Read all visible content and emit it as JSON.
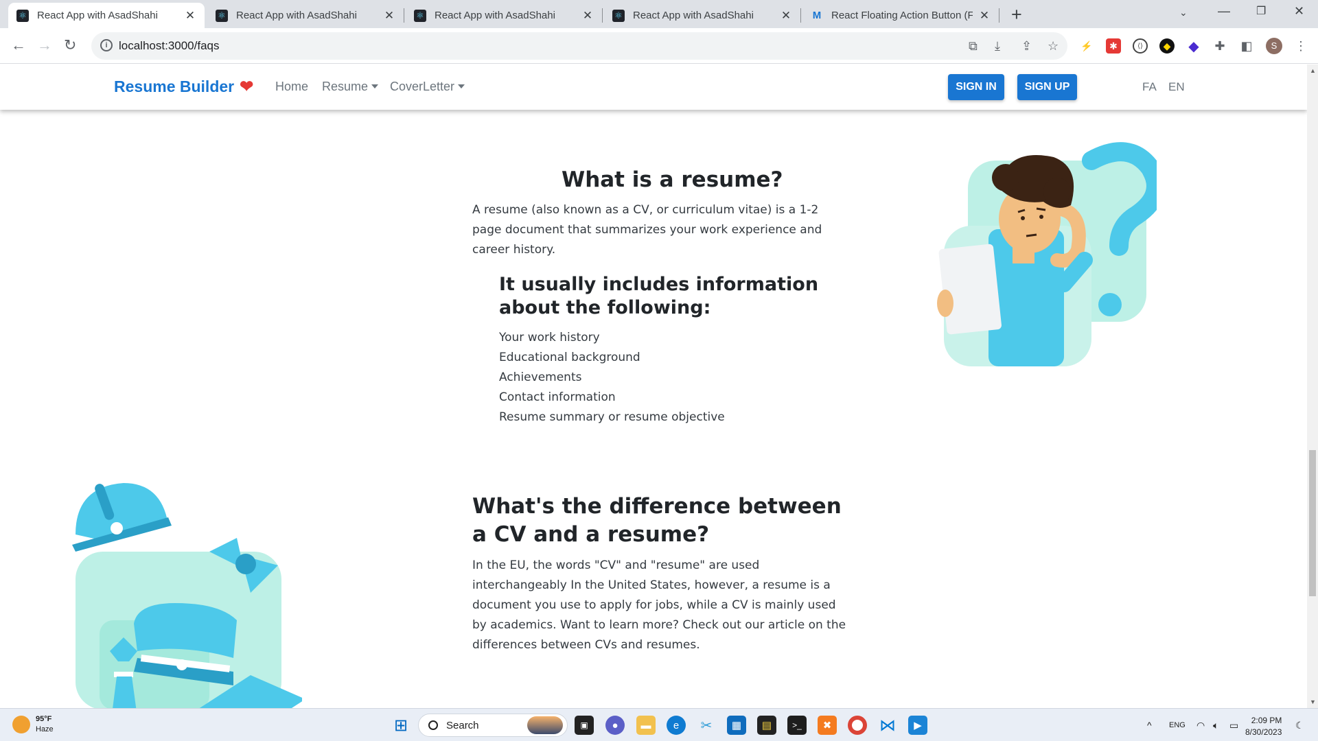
{
  "browser": {
    "tabs": [
      {
        "title": "React App with AsadShahi",
        "icon": "react-icon",
        "active": true
      },
      {
        "title": "React App with AsadShahi",
        "icon": "react-icon",
        "active": false
      },
      {
        "title": "React App with AsadShahi",
        "icon": "react-icon",
        "active": false
      },
      {
        "title": "React App with AsadShahi",
        "icon": "react-icon",
        "active": false
      },
      {
        "title": "React Floating Action Button (FA",
        "icon": "mui-icon",
        "active": false
      }
    ],
    "url": "localhost:3000/faqs"
  },
  "app_nav": {
    "brand": "Resume Builder",
    "brand_icon": "heart-icon",
    "links": [
      "Home",
      "Resume",
      "CoverLetter"
    ],
    "sign_in": "SIGN IN",
    "sign_up": "SIGN UP",
    "languages": [
      "FA",
      "EN"
    ],
    "accent": "#1976d2"
  },
  "faq": [
    {
      "heading": "What is a resume?",
      "body": "A resume (also known as a CV, or curriculum vitae) is a 1-2 page document that summarizes your work experience and career history.",
      "sub_heading": "It usually includes information about the following:",
      "items": [
        "Your work history",
        "Educational background",
        "Achievements",
        "Contact information",
        "Resume summary or resume objective"
      ],
      "illustration": "confused-person-with-question-mark"
    },
    {
      "heading": "What's the difference between a CV and a resume?",
      "body": "In the EU, the words \"CV\" and \"resume\" are used interchangeably In the United States, however, a resume is a document you use to apply for jobs, while a CV is mainly used by academics. Want to learn more? Check out our article on the differences between CVs and resumes.",
      "illustration": "hats-and-tie"
    }
  ],
  "taskbar": {
    "weather_temp": "95°F",
    "weather_desc": "Haze",
    "search_placeholder": "Search",
    "lang": "ENG",
    "time": "2:09 PM",
    "date": "8/30/2023"
  },
  "profile_initial": "S"
}
